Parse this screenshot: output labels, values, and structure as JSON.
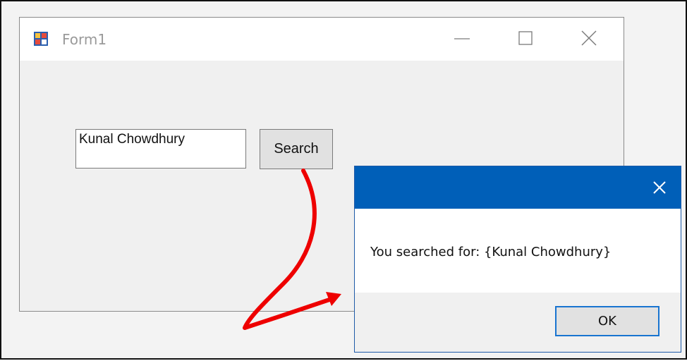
{
  "form": {
    "title": "Form1",
    "search_value": "Kunal Chowdhury",
    "search_label": "Search"
  },
  "message_box": {
    "text": "You searched for: {Kunal Chowdhury}",
    "ok_label": "OK"
  },
  "colors": {
    "accent": "#005fb8",
    "arrow": "#ee0000",
    "window_bg": "#f0f0f0"
  },
  "icons": {
    "app": "winforms-app-icon",
    "minimize": "minimize-icon",
    "maximize": "maximize-icon",
    "close": "close-icon",
    "dialog_close": "close-icon"
  }
}
